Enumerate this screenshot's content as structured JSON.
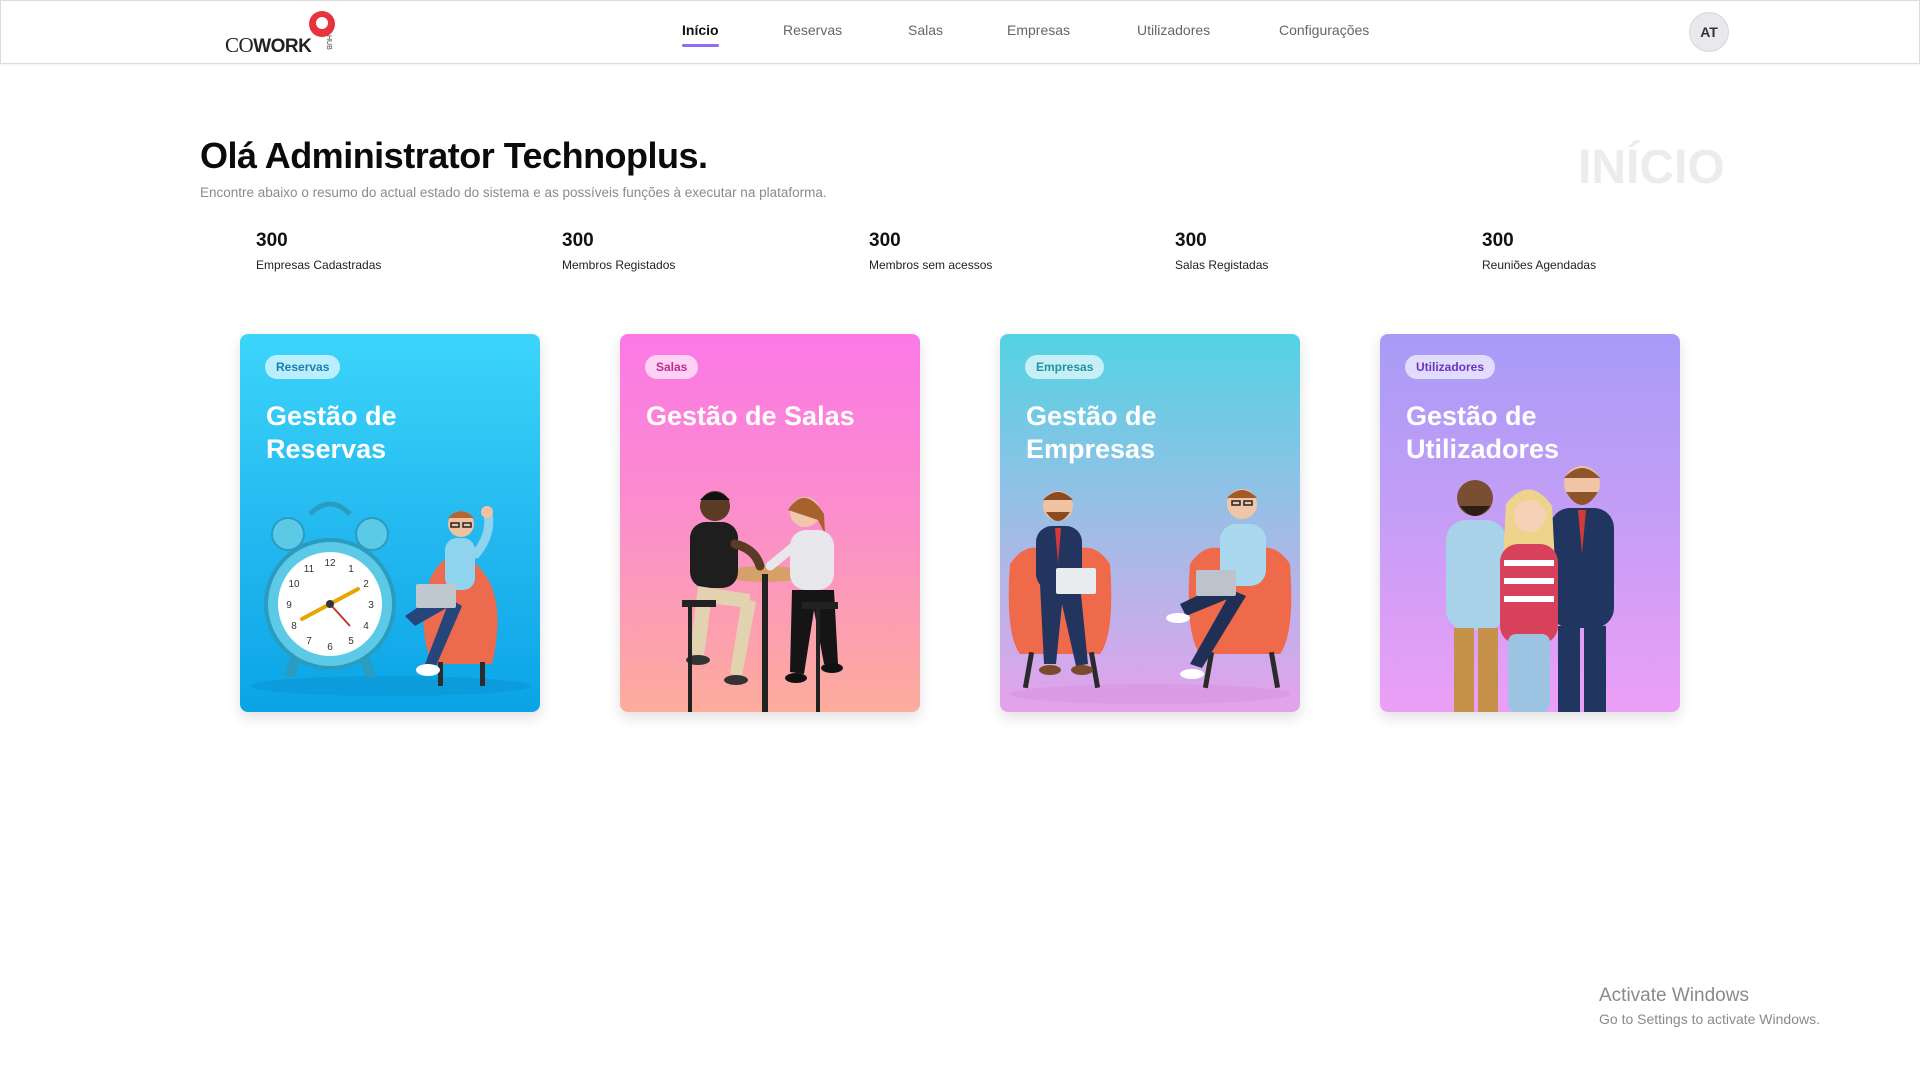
{
  "app": {
    "logo_main": "CO",
    "logo_bold": "WORK",
    "logo_sub": "HUB"
  },
  "nav": {
    "items": [
      {
        "label": "Início",
        "active": true
      },
      {
        "label": "Reservas"
      },
      {
        "label": "Salas"
      },
      {
        "label": "Empresas"
      },
      {
        "label": "Utilizadores"
      },
      {
        "label": "Configurações"
      }
    ],
    "avatar": "AT"
  },
  "header": {
    "greeting": "Olá Administrator Technoplus.",
    "subtitle": "Encontre abaixo o resumo do actual estado do sistema e as possíveis funções à executar na plataforma.",
    "watermark": "INÍCIO"
  },
  "stats": [
    {
      "value": "300",
      "label": "Empresas Cadastradas"
    },
    {
      "value": "300",
      "label": "Membros Registados"
    },
    {
      "value": "300",
      "label": "Membros sem acessos"
    },
    {
      "value": "300",
      "label": "Salas Registadas"
    },
    {
      "value": "300",
      "label": "Reuniões Agendadas"
    }
  ],
  "cards": [
    {
      "tag": "Reservas",
      "title": "Gestão de Reservas",
      "tag_color": "#1a7fb0"
    },
    {
      "tag": "Salas",
      "title": "Gestão de Salas",
      "tag_color": "#c02c8d"
    },
    {
      "tag": "Empresas",
      "title": "Gestão de Empresas",
      "tag_color": "#1d93a4"
    },
    {
      "tag": "Utilizadores",
      "title": "Gestão de Utilizadores",
      "tag_color": "#6a33c2"
    }
  ],
  "clock_numbers": [
    "12",
    "1",
    "2",
    "3",
    "4",
    "5",
    "6",
    "7",
    "8",
    "9",
    "10",
    "11"
  ],
  "os_overlay": {
    "line1": "Activate Windows",
    "line2": "Go to Settings to activate Windows."
  }
}
